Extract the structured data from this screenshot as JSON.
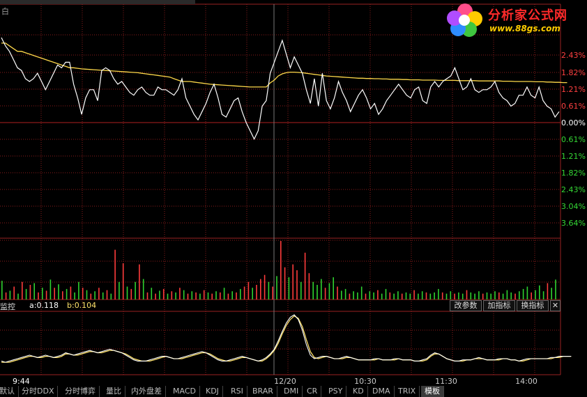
{
  "header": {
    "label": "白"
  },
  "logo": {
    "title": "分析家公式网",
    "url": "www.88gs.com",
    "icon": "flower-logo-icon"
  },
  "price_axis": {
    "labels": [
      "2.43%",
      "1.82%",
      "1.21%",
      "0.61%",
      "0.00%",
      "0.61%",
      "1.21%",
      "1.82%",
      "2.43%",
      "3.04%",
      "3.64%"
    ],
    "colors": [
      "red",
      "red",
      "red",
      "red",
      "white",
      "green",
      "green",
      "green",
      "green",
      "green",
      "green"
    ]
  },
  "indicator": {
    "name": "监控",
    "a_label": "a:0.118",
    "b_label": "b:0.104",
    "buttons": [
      "改参数",
      "加指标",
      "换指标"
    ],
    "close": "✕"
  },
  "time_axis": {
    "labels": [
      "9:44",
      "12/20",
      "10:30",
      "11:30",
      "14:00"
    ]
  },
  "tabs": [
    "默认",
    "分时DDX",
    "分时博弈",
    "量比",
    "内外盘差",
    "MACD",
    "KDJ",
    "RSI",
    "BRAR",
    "DMI",
    "CR",
    "PSY",
    "KD",
    "DMA",
    "TRIX",
    "模板"
  ],
  "active_tab": "模板",
  "colors": {
    "price": "#ffffff",
    "avg": "#ffd94a",
    "up": "#ff3b3b",
    "down": "#2fd12f",
    "grid": "#8b1b1b",
    "ind_a": "#ffffff",
    "ind_b": "#ffe36b"
  },
  "chart_data": {
    "type": "line",
    "ylim": [
      -3.64,
      3.04
    ],
    "price": [
      3.1,
      2.8,
      2.6,
      2.3,
      2.0,
      1.9,
      1.6,
      1.5,
      1.6,
      1.8,
      1.5,
      1.2,
      1.5,
      1.8,
      2.1,
      2.0,
      2.2,
      2.2,
      1.4,
      0.9,
      0.3,
      0.9,
      1.2,
      1.2,
      0.8,
      1.9,
      2.0,
      1.9,
      1.6,
      1.4,
      1.5,
      1.3,
      1.1,
      1.0,
      1.2,
      1.3,
      1.1,
      1.0,
      1.0,
      1.3,
      1.2,
      1.2,
      1.1,
      1.0,
      1.2,
      1.6,
      0.9,
      0.6,
      0.3,
      0.1,
      0.4,
      0.7,
      1.1,
      1.4,
      0.9,
      0.3,
      0.2,
      0.5,
      0.8,
      0.9,
      0.4,
      0.0,
      -0.3,
      -0.6,
      -0.3,
      0.6,
      0.8,
      1.8,
      2.2,
      2.6,
      3.0,
      2.5,
      2.0,
      2.4,
      2.1,
      1.8,
      1.2,
      0.7,
      1.6,
      0.6,
      1.8,
      0.8,
      0.5,
      0.9,
      1.5,
      1.1,
      0.8,
      0.4,
      0.7,
      1.0,
      1.2,
      0.9,
      0.5,
      0.7,
      0.3,
      0.5,
      0.8,
      1.0,
      1.2,
      1.4,
      1.2,
      1.0,
      0.9,
      1.2,
      1.3,
      0.8,
      0.7,
      1.3,
      1.5,
      1.3,
      1.5,
      1.6,
      1.7,
      2.0,
      1.6,
      1.2,
      1.3,
      1.6,
      1.2,
      1.1,
      1.2,
      1.2,
      1.3,
      1.5,
      1.1,
      0.9,
      0.8,
      0.6,
      0.7,
      1.0,
      1.0,
      1.3,
      1.0,
      0.9,
      1.3,
      0.8,
      0.6,
      0.5,
      0.2,
      0.4
    ],
    "avg": [
      2.9,
      2.9,
      2.8,
      2.7,
      2.6,
      2.6,
      2.55,
      2.5,
      2.45,
      2.4,
      2.35,
      2.3,
      2.25,
      2.2,
      2.15,
      2.1,
      2.05,
      2.0,
      2.0,
      1.98,
      1.96,
      1.95,
      1.94,
      1.93,
      1.92,
      1.91,
      1.9,
      1.89,
      1.88,
      1.87,
      1.86,
      1.85,
      1.84,
      1.83,
      1.82,
      1.8,
      1.78,
      1.76,
      1.74,
      1.72,
      1.7,
      1.68,
      1.66,
      1.6,
      1.55,
      1.5,
      1.5,
      1.5,
      1.48,
      1.46,
      1.44,
      1.42,
      1.4,
      1.39,
      1.38,
      1.37,
      1.36,
      1.35,
      1.34,
      1.33,
      1.32,
      1.31,
      1.3,
      1.3,
      1.3,
      1.3,
      1.3,
      1.45,
      1.55,
      1.7,
      1.78,
      1.82,
      1.84,
      1.84,
      1.83,
      1.82,
      1.8,
      1.78,
      1.76,
      1.74,
      1.72,
      1.7,
      1.69,
      1.68,
      1.67,
      1.66,
      1.65,
      1.64,
      1.63,
      1.62,
      1.62,
      1.61,
      1.61,
      1.6,
      1.6,
      1.59,
      1.59,
      1.58,
      1.58,
      1.58,
      1.57,
      1.57,
      1.56,
      1.56,
      1.56,
      1.55,
      1.55,
      1.55,
      1.55,
      1.54,
      1.54,
      1.54,
      1.54,
      1.54,
      1.53,
      1.53,
      1.53,
      1.53,
      1.53,
      1.52,
      1.52,
      1.52,
      1.52,
      1.52,
      1.52,
      1.51,
      1.51,
      1.51,
      1.5,
      1.5,
      1.5,
      1.5,
      1.5,
      1.49,
      1.49,
      1.49,
      1.48,
      1.48,
      1.47,
      1.47,
      1.46,
      1.46
    ],
    "indicator_a": [
      0.08,
      0.07,
      0.08,
      0.09,
      0.1,
      0.11,
      0.12,
      0.13,
      0.12,
      0.11,
      0.12,
      0.13,
      0.12,
      0.11,
      0.12,
      0.13,
      0.15,
      0.14,
      0.13,
      0.14,
      0.15,
      0.16,
      0.17,
      0.16,
      0.15,
      0.16,
      0.17,
      0.18,
      0.17,
      0.16,
      0.15,
      0.13,
      0.11,
      0.09,
      0.08,
      0.08,
      0.08,
      0.09,
      0.1,
      0.11,
      0.12,
      0.12,
      0.11,
      0.1,
      0.1,
      0.11,
      0.12,
      0.13,
      0.14,
      0.15,
      0.16,
      0.15,
      0.13,
      0.11,
      0.09,
      0.08,
      0.08,
      0.09,
      0.1,
      0.11,
      0.12,
      0.11,
      0.1,
      0.09,
      0.08,
      0.09,
      0.11,
      0.14,
      0.18,
      0.25,
      0.33,
      0.4,
      0.45,
      0.47,
      0.43,
      0.34,
      0.22,
      0.13,
      0.1,
      0.11,
      0.12,
      0.12,
      0.11,
      0.1,
      0.1,
      0.11,
      0.12,
      0.11,
      0.1,
      0.09,
      0.09,
      0.09,
      0.09,
      0.1,
      0.1,
      0.09,
      0.09,
      0.09,
      0.1,
      0.1,
      0.09,
      0.09,
      0.09,
      0.08,
      0.08,
      0.09,
      0.1,
      0.13,
      0.15,
      0.14,
      0.12,
      0.1,
      0.09,
      0.08,
      0.08,
      0.09,
      0.09,
      0.09,
      0.1,
      0.11,
      0.1,
      0.09,
      0.09,
      0.09,
      0.1,
      0.1,
      0.1,
      0.09,
      0.09,
      0.08,
      0.09,
      0.1,
      0.1,
      0.1,
      0.1,
      0.1,
      0.1,
      0.11,
      0.11,
      0.12,
      0.12,
      0.12,
      0.12
    ],
    "indicator_b": [
      0.07,
      0.07,
      0.07,
      0.08,
      0.09,
      0.1,
      0.11,
      0.12,
      0.12,
      0.11,
      0.11,
      0.12,
      0.12,
      0.11,
      0.11,
      0.12,
      0.14,
      0.14,
      0.13,
      0.13,
      0.14,
      0.15,
      0.16,
      0.16,
      0.15,
      0.15,
      0.16,
      0.17,
      0.17,
      0.16,
      0.15,
      0.14,
      0.12,
      0.1,
      0.09,
      0.08,
      0.08,
      0.08,
      0.09,
      0.1,
      0.11,
      0.12,
      0.11,
      0.1,
      0.1,
      0.1,
      0.11,
      0.12,
      0.13,
      0.14,
      0.15,
      0.15,
      0.14,
      0.12,
      0.1,
      0.09,
      0.08,
      0.08,
      0.09,
      0.1,
      0.11,
      0.11,
      0.1,
      0.09,
      0.08,
      0.08,
      0.1,
      0.13,
      0.17,
      0.23,
      0.31,
      0.38,
      0.43,
      0.46,
      0.44,
      0.37,
      0.26,
      0.16,
      0.11,
      0.1,
      0.11,
      0.12,
      0.11,
      0.1,
      0.1,
      0.1,
      0.11,
      0.11,
      0.1,
      0.09,
      0.09,
      0.09,
      0.09,
      0.09,
      0.1,
      0.09,
      0.09,
      0.09,
      0.09,
      0.1,
      0.09,
      0.09,
      0.09,
      0.08,
      0.08,
      0.08,
      0.09,
      0.12,
      0.14,
      0.14,
      0.12,
      0.1,
      0.09,
      0.08,
      0.08,
      0.08,
      0.09,
      0.09,
      0.1,
      0.1,
      0.1,
      0.09,
      0.09,
      0.09,
      0.09,
      0.1,
      0.1,
      0.09,
      0.09,
      0.08,
      0.08,
      0.09,
      0.1,
      0.1,
      0.1,
      0.1,
      0.1,
      0.1,
      0.11,
      0.11,
      0.12,
      0.12,
      0.12
    ],
    "volume": [
      {
        "v": 0.32,
        "up": false
      },
      {
        "v": 0.12,
        "up": true
      },
      {
        "v": 0.15,
        "up": false
      },
      {
        "v": 0.22,
        "up": true
      },
      {
        "v": 0.1,
        "up": false
      },
      {
        "v": 0.3,
        "up": true
      },
      {
        "v": 0.18,
        "up": false
      },
      {
        "v": 0.25,
        "up": true
      },
      {
        "v": 0.28,
        "up": false
      },
      {
        "v": 0.12,
        "up": true
      },
      {
        "v": 0.2,
        "up": false
      },
      {
        "v": 0.15,
        "up": true
      },
      {
        "v": 0.34,
        "up": false
      },
      {
        "v": 0.2,
        "up": true
      },
      {
        "v": 0.26,
        "up": false
      },
      {
        "v": 0.14,
        "up": true
      },
      {
        "v": 0.18,
        "up": false
      },
      {
        "v": 0.22,
        "up": true
      },
      {
        "v": 0.12,
        "up": false
      },
      {
        "v": 0.3,
        "up": false
      },
      {
        "v": 0.2,
        "up": true
      },
      {
        "v": 0.16,
        "up": false
      },
      {
        "v": 0.1,
        "up": true
      },
      {
        "v": 0.14,
        "up": false
      },
      {
        "v": 0.2,
        "up": true
      },
      {
        "v": 0.12,
        "up": false
      },
      {
        "v": 0.16,
        "up": true
      },
      {
        "v": 0.1,
        "up": false
      },
      {
        "v": 0.85,
        "up": true
      },
      {
        "v": 0.3,
        "up": false
      },
      {
        "v": 0.62,
        "up": true
      },
      {
        "v": 0.22,
        "up": false
      },
      {
        "v": 0.18,
        "up": true
      },
      {
        "v": 0.3,
        "up": false
      },
      {
        "v": 0.6,
        "up": true
      },
      {
        "v": 0.35,
        "up": false
      },
      {
        "v": 0.12,
        "up": true
      },
      {
        "v": 0.2,
        "up": false
      },
      {
        "v": 0.1,
        "up": true
      },
      {
        "v": 0.15,
        "up": false
      },
      {
        "v": 0.18,
        "up": true
      },
      {
        "v": 0.1,
        "up": false
      },
      {
        "v": 0.14,
        "up": true
      },
      {
        "v": 0.12,
        "up": false
      },
      {
        "v": 0.2,
        "up": true
      },
      {
        "v": 0.16,
        "up": false
      },
      {
        "v": 0.1,
        "up": true
      },
      {
        "v": 0.14,
        "up": false
      },
      {
        "v": 0.12,
        "up": true
      },
      {
        "v": 0.1,
        "up": false
      },
      {
        "v": 0.16,
        "up": true
      },
      {
        "v": 0.12,
        "up": false
      },
      {
        "v": 0.1,
        "up": true
      },
      {
        "v": 0.14,
        "up": false
      },
      {
        "v": 0.12,
        "up": true
      },
      {
        "v": 0.2,
        "up": false
      },
      {
        "v": 0.1,
        "up": true
      },
      {
        "v": 0.14,
        "up": false
      },
      {
        "v": 0.12,
        "up": true
      },
      {
        "v": 0.18,
        "up": false
      },
      {
        "v": 0.22,
        "up": true
      },
      {
        "v": 0.3,
        "up": true
      },
      {
        "v": 0.2,
        "up": false
      },
      {
        "v": 0.25,
        "up": true
      },
      {
        "v": 0.35,
        "up": true
      },
      {
        "v": 0.42,
        "up": true
      },
      {
        "v": 0.3,
        "up": false
      },
      {
        "v": 0.22,
        "up": true
      },
      {
        "v": 0.4,
        "up": false
      },
      {
        "v": 1.0,
        "up": true
      },
      {
        "v": 0.55,
        "up": true
      },
      {
        "v": 0.38,
        "up": false
      },
      {
        "v": 0.6,
        "up": true
      },
      {
        "v": 0.5,
        "up": true
      },
      {
        "v": 0.3,
        "up": false
      },
      {
        "v": 0.8,
        "up": true
      },
      {
        "v": 0.45,
        "up": true
      },
      {
        "v": 0.3,
        "up": false
      },
      {
        "v": 0.25,
        "up": false
      },
      {
        "v": 0.35,
        "up": false
      },
      {
        "v": 0.2,
        "up": true
      },
      {
        "v": 0.28,
        "up": false
      },
      {
        "v": 0.38,
        "up": false
      },
      {
        "v": 0.22,
        "up": true
      },
      {
        "v": 0.15,
        "up": false
      },
      {
        "v": 0.18,
        "up": false
      },
      {
        "v": 0.1,
        "up": true
      },
      {
        "v": 0.14,
        "up": false
      },
      {
        "v": 0.12,
        "up": false
      },
      {
        "v": 0.22,
        "up": false
      },
      {
        "v": 0.1,
        "up": true
      },
      {
        "v": 0.14,
        "up": false
      },
      {
        "v": 0.12,
        "up": false
      },
      {
        "v": 0.16,
        "up": true
      },
      {
        "v": 0.1,
        "up": false
      },
      {
        "v": 0.18,
        "up": false
      },
      {
        "v": 0.12,
        "up": true
      },
      {
        "v": 0.1,
        "up": false
      },
      {
        "v": 0.14,
        "up": false
      },
      {
        "v": 0.1,
        "up": true
      },
      {
        "v": 0.12,
        "up": false
      },
      {
        "v": 0.1,
        "up": false
      },
      {
        "v": 0.16,
        "up": true
      },
      {
        "v": 0.1,
        "up": false
      },
      {
        "v": 0.14,
        "up": false
      },
      {
        "v": 0.12,
        "up": true
      },
      {
        "v": 0.1,
        "up": false
      },
      {
        "v": 0.12,
        "up": false
      },
      {
        "v": 0.18,
        "up": false
      },
      {
        "v": 0.12,
        "up": true
      },
      {
        "v": 0.1,
        "up": false
      },
      {
        "v": 0.14,
        "up": false
      },
      {
        "v": 0.1,
        "up": true
      },
      {
        "v": 0.12,
        "up": false
      },
      {
        "v": 0.1,
        "up": false
      },
      {
        "v": 0.16,
        "up": true
      },
      {
        "v": 0.12,
        "up": false
      },
      {
        "v": 0.1,
        "up": false
      },
      {
        "v": 0.14,
        "up": false
      },
      {
        "v": 0.1,
        "up": true
      },
      {
        "v": 0.12,
        "up": false
      },
      {
        "v": 0.1,
        "up": false
      },
      {
        "v": 0.14,
        "up": false
      },
      {
        "v": 0.12,
        "up": true
      },
      {
        "v": 0.1,
        "up": false
      },
      {
        "v": 0.16,
        "up": false
      },
      {
        "v": 0.12,
        "up": false
      },
      {
        "v": 0.1,
        "up": true
      },
      {
        "v": 0.14,
        "up": false
      },
      {
        "v": 0.18,
        "up": false
      },
      {
        "v": 0.22,
        "up": false
      },
      {
        "v": 0.12,
        "up": true
      },
      {
        "v": 0.16,
        "up": false
      },
      {
        "v": 0.24,
        "up": false
      },
      {
        "v": 0.14,
        "up": false
      },
      {
        "v": 0.28,
        "up": true
      },
      {
        "v": 0.2,
        "up": false
      },
      {
        "v": 0.34,
        "up": false
      }
    ]
  }
}
